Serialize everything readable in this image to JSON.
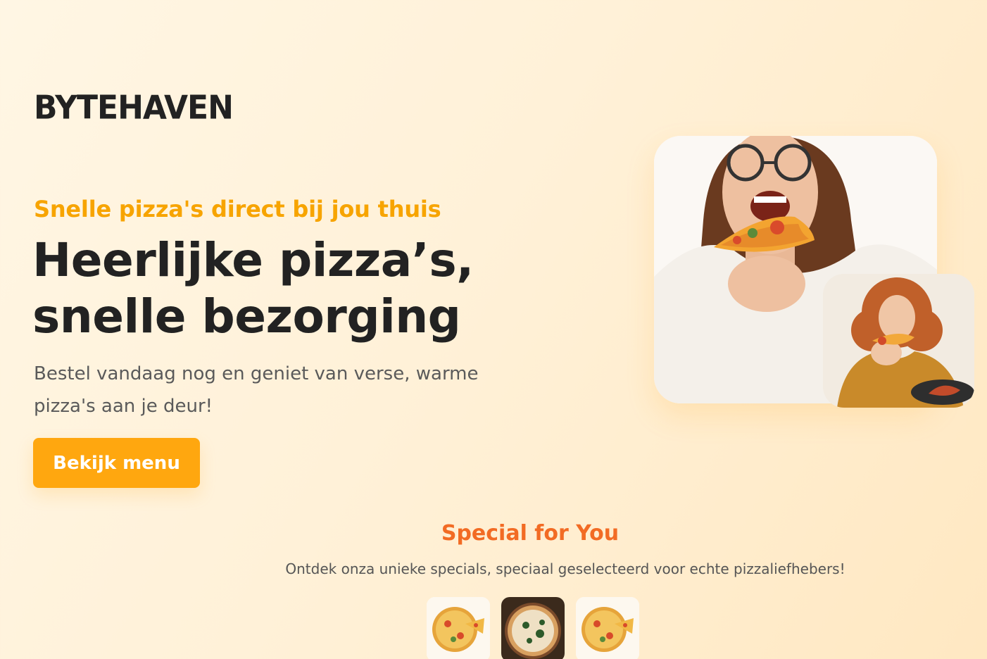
{
  "brand": {
    "logo": "BYTEHAVEN",
    "accent_color": "#ffa70f",
    "secondary_color": "#f26b24"
  },
  "hero": {
    "subtitle": "Snelle pizza's direct bij jou thuis",
    "title": "Heerlijke pizza’s, snelle bezorging",
    "description": "Bestel vandaag nog en geniet van verse, warme pizza's aan je deur!",
    "cta_label": "Bekijk menu",
    "images": [
      {
        "icon": "woman-eating-pizza-photo"
      },
      {
        "icon": "girl-eating-pizza-photo"
      }
    ]
  },
  "specials": {
    "title": "Special for You",
    "description": "Ontdek onza unieke specials, speciaal geselecteerd voor echte pizzaliefhebers!",
    "items": [
      {
        "icon": "pizza-photo"
      },
      {
        "icon": "pizza-photo"
      },
      {
        "icon": "pizza-photo"
      }
    ]
  }
}
